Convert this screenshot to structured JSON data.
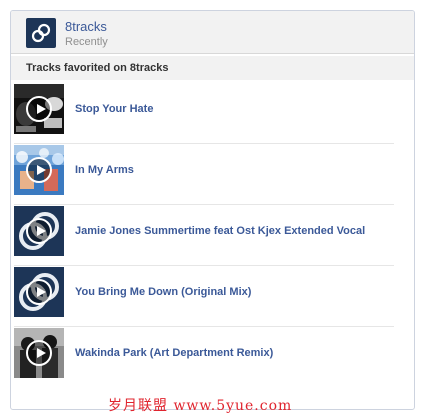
{
  "app": {
    "name": "8tracks",
    "subtitle": "Recently",
    "icon": "8tracks-logo-icon",
    "brand_color": "#1d3557"
  },
  "section": {
    "title": "Tracks favorited on 8tracks"
  },
  "tracks": [
    {
      "title": "Stop Your Hate",
      "thumb": "dark-photo"
    },
    {
      "title": "In My Arms",
      "thumb": "blue-bokeh-photo"
    },
    {
      "title": "Jamie Jones Summertime feat Ost Kjex Extended Vocal",
      "thumb": "8tracks-default"
    },
    {
      "title": "You Bring Me Down (Original Mix)",
      "thumb": "8tracks-default"
    },
    {
      "title": "Wakinda Park (Art Department Remix)",
      "thumb": "band-photo"
    }
  ],
  "colors": {
    "link": "#3b5998",
    "header_bg": "#f2f2f2",
    "watermark": "#e0242e"
  },
  "watermark": "岁月联盟 www.5yue.com"
}
